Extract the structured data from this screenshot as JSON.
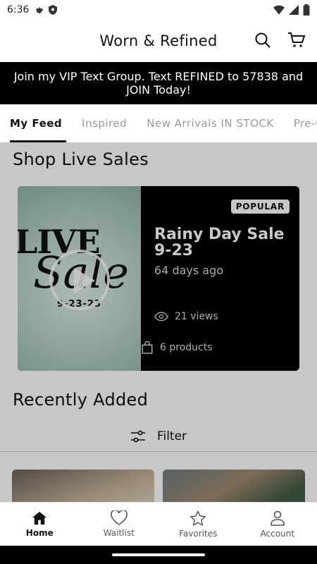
{
  "status_bar": {
    "time": "6:36"
  },
  "app": {
    "title": "Worn & Refined"
  },
  "banner": {
    "text": "Join my VIP Text Group. Text REFINED to 57838 and JOIN Today!"
  },
  "tabs": [
    {
      "label": "My Feed",
      "active": true
    },
    {
      "label": "Inspired",
      "active": false
    },
    {
      "label": "New Arrivals IN STOCK",
      "active": false
    },
    {
      "label": "Pre-O",
      "active": false
    }
  ],
  "live_sales": {
    "section_title": "Shop Live Sales",
    "card": {
      "thumbnail_text": {
        "line1": "LIVE",
        "line2": "Sale",
        "date": "9-23-23"
      },
      "badge": "POPULAR",
      "title": "Rainy Day Sale 9-23",
      "ago": "64 days ago",
      "views": "21 views",
      "products": "6 products"
    }
  },
  "recently_added": {
    "section_title": "Recently Added",
    "filter_label": "Filter"
  },
  "bottom_nav": [
    {
      "label": "Home",
      "icon": "home-icon",
      "active": true
    },
    {
      "label": "Waitlist",
      "icon": "heart-icon",
      "active": false
    },
    {
      "label": "Favorites",
      "icon": "star-icon",
      "active": false
    },
    {
      "label": "Account",
      "icon": "person-icon",
      "active": false
    }
  ],
  "colors": {
    "banner_bg": "#000000",
    "card_bg": "#000000",
    "badge_bg": "#ffffff"
  }
}
